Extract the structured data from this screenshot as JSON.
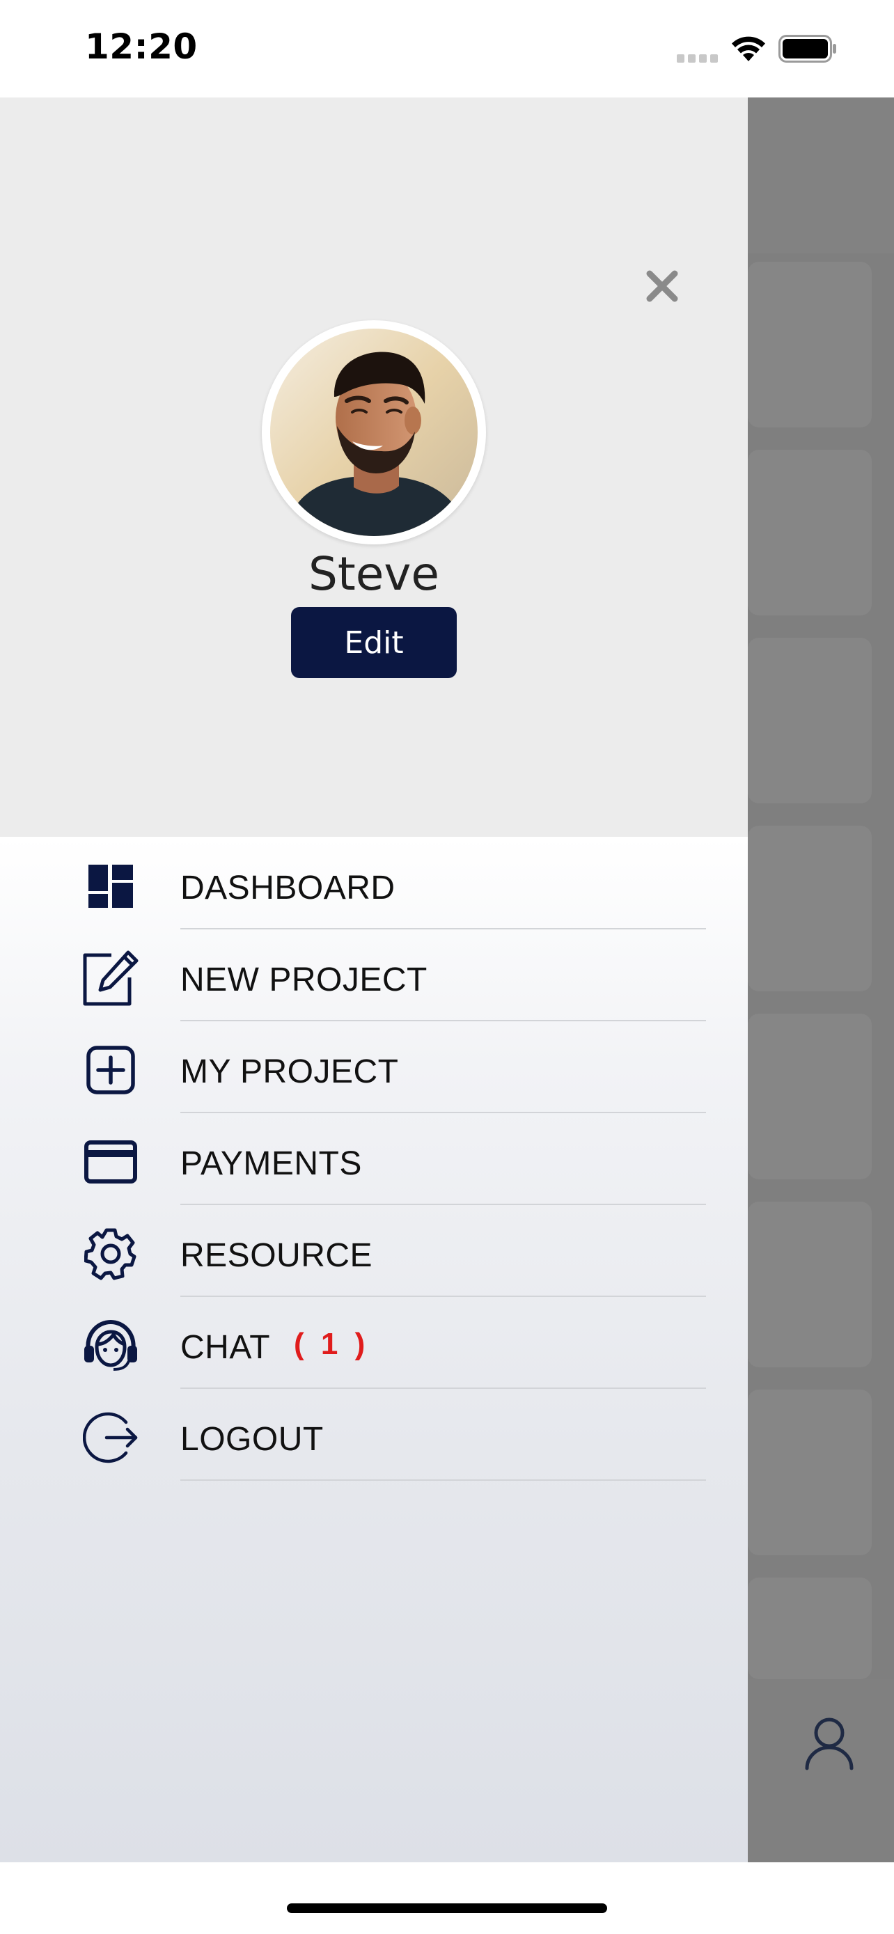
{
  "status_bar": {
    "time": "12:20",
    "signal_icon": "signal-dots-icon",
    "wifi_icon": "wifi-icon",
    "battery_icon": "battery-full-icon"
  },
  "drawer": {
    "close_icon": "close-icon",
    "profile": {
      "avatar_icon": "profile-photo",
      "name": "Steve",
      "edit_label": "Edit"
    },
    "menu": [
      {
        "label": "DASHBOARD",
        "icon": "dashboard-icon"
      },
      {
        "label": "NEW PROJECT",
        "icon": "edit-square-icon"
      },
      {
        "label": "MY PROJECT",
        "icon": "plus-square-icon"
      },
      {
        "label": "PAYMENTS",
        "icon": "credit-card-icon"
      },
      {
        "label": "RESOURCE",
        "icon": "gear-icon"
      },
      {
        "label": "CHAT",
        "icon": "support-agent-icon",
        "badge": "( 1 )"
      },
      {
        "label": "LOGOUT",
        "icon": "logout-icon"
      }
    ]
  },
  "background_app": {
    "tabbar_icon": "user-icon"
  },
  "colors": {
    "primary": "#0b1742",
    "badge": "#e01c1c",
    "overlay": "#7f7f7f",
    "header_bg": "#ececec"
  }
}
